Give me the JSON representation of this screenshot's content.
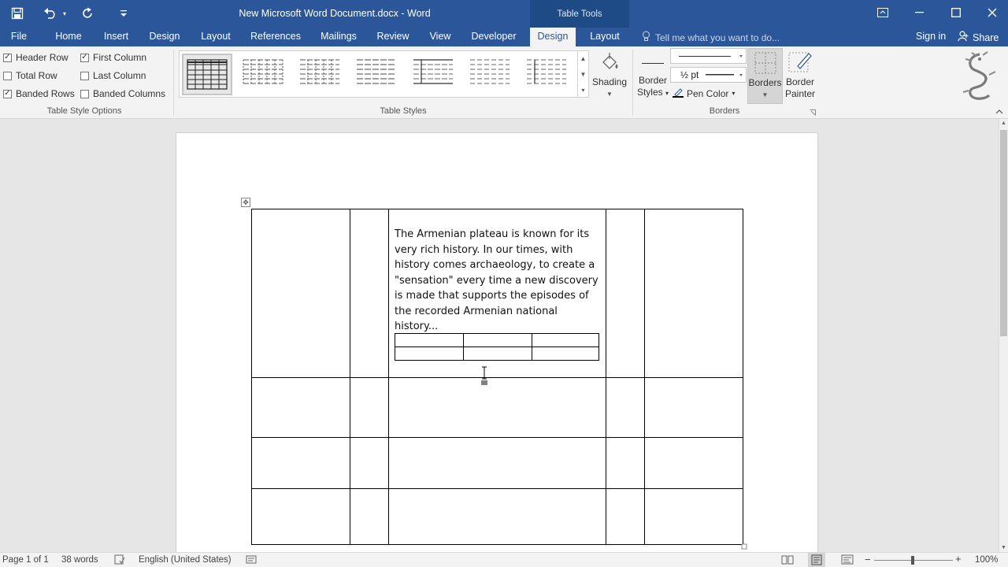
{
  "title_bar": {
    "document_title": "New Microsoft Word Document.docx - Word",
    "contextual_group": "Table Tools",
    "quick_access": [
      "save-icon",
      "undo-icon",
      "redo-icon",
      "customize-icon"
    ]
  },
  "tabs": [
    "File",
    "Home",
    "Insert",
    "Design",
    "Layout",
    "References",
    "Mailings",
    "Review",
    "View",
    "Developer",
    "Design",
    "Layout"
  ],
  "active_tab_index": 10,
  "tell_me": "Tell me what you want to do...",
  "sign_in": "Sign in",
  "share": "Share",
  "table_style_options": {
    "label": "Table Style Options",
    "checkboxes": [
      {
        "label": "Header Row",
        "checked": true
      },
      {
        "label": "First Column",
        "checked": true
      },
      {
        "label": "Total Row",
        "checked": false
      },
      {
        "label": "Last Column",
        "checked": false
      },
      {
        "label": "Banded Rows",
        "checked": true
      },
      {
        "label": "Banded Columns",
        "checked": false
      }
    ]
  },
  "table_styles": {
    "label": "Table Styles",
    "shading": "Shading"
  },
  "borders_group": {
    "label": "Borders",
    "border_styles": [
      "Border",
      "Styles"
    ],
    "pen_weight": "½ pt",
    "pen_color": "Pen Color",
    "borders": "Borders",
    "border_painter": [
      "Border",
      "Painter"
    ]
  },
  "document": {
    "paragraph": [
      "The Armenian plateau is known for its",
      "very rich history. In our times, with",
      "history comes archaeology, to create a",
      "\"sensation\" every time a new discovery",
      "is made that supports the episodes of",
      "the recorded Armenian national",
      "history..."
    ]
  },
  "status_bar": {
    "page": "Page 1 of 1",
    "words": "38 words",
    "language": "English (United States)",
    "zoom": "100%"
  },
  "colors": {
    "accent": "#2b579a",
    "contextual": "#1e4a85"
  }
}
